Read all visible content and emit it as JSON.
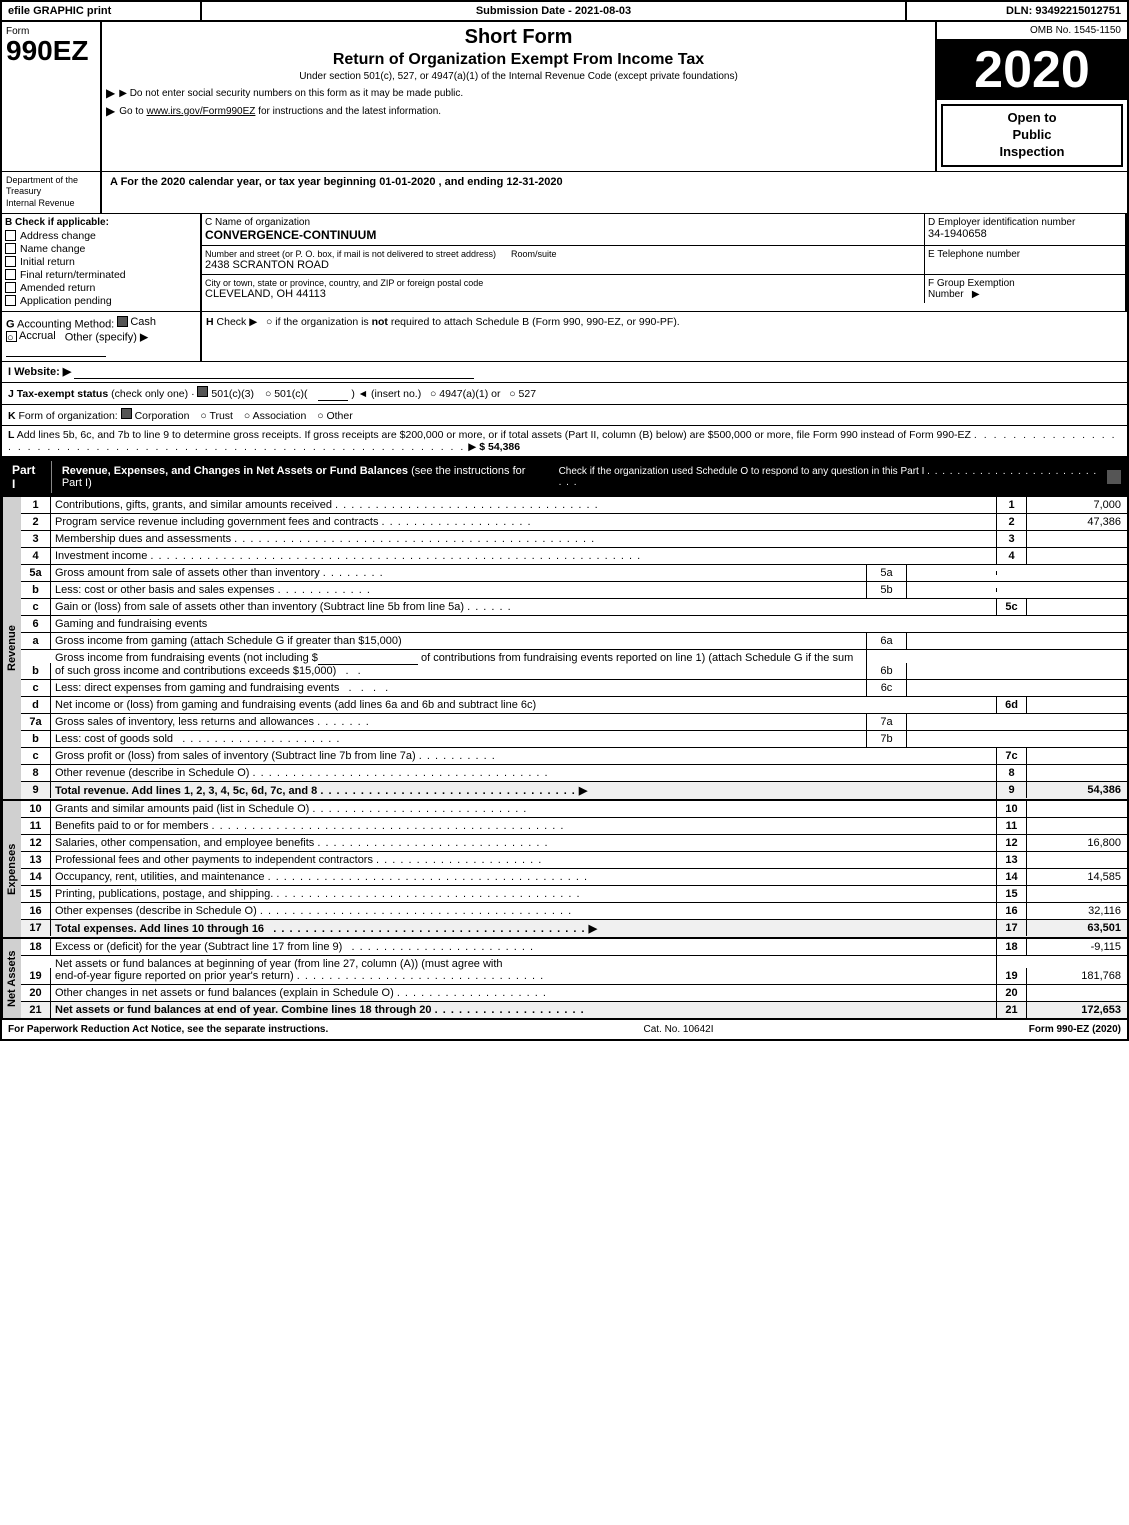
{
  "header": {
    "efile_label": "efile GRAPHIC print",
    "submission_label": "Submission Date - 2021-08-03",
    "dln_label": "DLN: 93492215012751"
  },
  "form": {
    "form_number": "990EZ",
    "short_form_title": "Short Form",
    "return_title": "Return of Organization Exempt From Income Tax",
    "subtitle": "Under section 501(c), 527, or 4947(a)(1) of the Internal Revenue Code (except private foundations)",
    "notice1": "▶ Do not enter social security numbers on this form as it may be made public.",
    "notice2": "▶ Go to www.irs.gov/Form990EZ for instructions and the latest information.",
    "omb": "OMB No. 1545-1150",
    "year": "2020",
    "open_to_public": "Open to\nPublic\nInspection",
    "dept": "Department of the Treasury\nInternal Revenue",
    "tax_year_line": "A For the 2020 calendar year, or tax year beginning 01-01-2020 , and ending 12-31-2020"
  },
  "section_b": {
    "label": "B Check if applicable:",
    "items": [
      {
        "id": "address_change",
        "label": "Address change",
        "checked": false
      },
      {
        "id": "name_change",
        "label": "Name change",
        "checked": false
      },
      {
        "id": "initial_return",
        "label": "Initial return",
        "checked": false
      },
      {
        "id": "final_return",
        "label": "Final return/terminated",
        "checked": false
      },
      {
        "id": "amended_return",
        "label": "Amended return",
        "checked": false
      },
      {
        "id": "application_pending",
        "label": "Application pending",
        "checked": false
      }
    ]
  },
  "section_c": {
    "label": "C Name of organization",
    "org_name": "CONVERGENCE-CONTINUUM"
  },
  "section_d": {
    "label": "D Employer identification number",
    "ein": "34-1940658"
  },
  "section_e": {
    "label": "E Telephone number"
  },
  "address": {
    "street_label": "Number and street (or P. O. box, if mail is not delivered to street address)",
    "room_label": "Room/suite",
    "street": "2438 SCRANTON ROAD",
    "city_label": "City or town, state or province, country, and ZIP or foreign postal code",
    "city": "CLEVELAND, OH  44113"
  },
  "section_f": {
    "label": "F Group Exemption\nNumber",
    "arrow": "▶"
  },
  "section_g": {
    "label": "G Accounting Method:",
    "cash_checked": true,
    "cash_label": "Cash",
    "accrual_label": "Accrual",
    "other_label": "Other (specify) ▶"
  },
  "section_h": {
    "label": "H Check ▶",
    "text": "○ if the organization is not required to attach Schedule B (Form 990, 990-EZ, or 990-PF)."
  },
  "section_i": {
    "label": "I Website: ▶"
  },
  "section_j": {
    "label": "J Tax-exempt status",
    "text": "(check only one) ·",
    "options": [
      "☑ 501(c)(3)",
      "○ 501(c)(",
      ") ◄ (insert no.)",
      "○ 4947(a)(1) or",
      "○ 527"
    ]
  },
  "section_k": {
    "label": "K Form of organization:",
    "options": [
      "☑ Corporation",
      "○ Trust",
      "○ Association",
      "○ Other"
    ]
  },
  "section_l": {
    "text": "L Add lines 5b, 6c, and 7b to line 9 to determine gross receipts. If gross receipts are $200,000 or more, or if total assets (Part II, column (B) below) are $500,000 or more, file Form 990 instead of Form 990-EZ",
    "dots": ". . . . . . . . . . . . . . . . . . . . . . . . . . . . . . . . . . . . . . . . . . . . . . . . . . . . . . . . . . .",
    "arrow": "▶",
    "value": "$ 54,386"
  },
  "part1": {
    "label": "Part I",
    "title": "Revenue, Expenses, and Changes in Net Assets or Fund Balances",
    "subtitle": "(see the instructions for Part I)",
    "check_note": "Check if the organization used Schedule O to respond to any question in this Part I",
    "check_dots": ". . . . . . . . . . . . . . . . . . . . . . . . .",
    "lines": [
      {
        "num": "1",
        "desc": "Contributions, gifts, grants, and similar amounts received",
        "dots": ". . . . . . . . . . . . . . . . . . . . . . . . . . . . . . . . .",
        "ref": "1",
        "value": "7,000"
      },
      {
        "num": "2",
        "desc": "Program service revenue including government fees and contracts",
        "dots": ". . . . . . . . . . . . . . . . . . .",
        "ref": "2",
        "value": "47,386"
      },
      {
        "num": "3",
        "desc": "Membership dues and assessments",
        "dots": ". . . . . . . . . . . . . . . . . . . . . . . . . . . . . . . . . . . . . . . . . . . . .",
        "ref": "3",
        "value": ""
      },
      {
        "num": "4",
        "desc": "Investment income",
        "dots": ". . . . . . . . . . . . . . . . . . . . . . . . . . . . . . . . . . . . . . . . . . . . . . . . . . . . . . . . . . . . .",
        "ref": "4",
        "value": ""
      },
      {
        "num": "5a",
        "desc": "Gross amount from sale of assets other than inventory",
        "dots": ". . . . . . . .",
        "sub": "5a",
        "value": ""
      },
      {
        "num": "b",
        "desc": "Less: cost or other basis and sales expenses",
        "dots": ". . . . . . . . . . . .",
        "sub": "5b",
        "value": ""
      },
      {
        "num": "c",
        "desc": "Gain or (loss) from sale of assets other than inventory (Subtract line 5b from line 5a)",
        "dots": ". . . . . .",
        "ref": "5c",
        "value": ""
      },
      {
        "num": "6",
        "desc": "Gaming and fundraising events",
        "dots": "",
        "ref": "",
        "value": ""
      },
      {
        "num": "a",
        "desc": "Gross income from gaming (attach Schedule G if greater than $15,000)",
        "sub": "6a",
        "value": ""
      },
      {
        "num": "b",
        "desc": "Gross income from fundraising events (not including $_____ of contributions from fundraising events reported on line 1) (attach Schedule G if the sum of such gross income and contributions exceeds $15,000)",
        "sub": "6b",
        "value": ""
      },
      {
        "num": "c",
        "desc": "Less: direct expenses from gaming and fundraising events",
        "dots": ". . . .",
        "sub": "6c",
        "value": ""
      },
      {
        "num": "d",
        "desc": "Net income or (loss) from gaming and fundraising events (add lines 6a and 6b and subtract line 6c)",
        "ref": "6d",
        "value": ""
      },
      {
        "num": "7a",
        "desc": "Gross sales of inventory, less returns and allowances",
        "dots": ". . . . . . .",
        "sub": "7a",
        "value": ""
      },
      {
        "num": "b",
        "desc": "Less: cost of goods sold",
        "dots": ". . . . . . . . . . . . . . . . . . . . .",
        "sub": "7b",
        "value": ""
      },
      {
        "num": "c",
        "desc": "Gross profit or (loss) from sales of inventory (Subtract line 7b from line 7a)",
        "dots": ". . . . . . . . . .",
        "ref": "7c",
        "value": ""
      },
      {
        "num": "8",
        "desc": "Other revenue (describe in Schedule O)",
        "dots": ". . . . . . . . . . . . . . . . . . . . . . . . . . . . . . . . . . . . .",
        "ref": "8",
        "value": ""
      },
      {
        "num": "9",
        "desc": "Total revenue. Add lines 1, 2, 3, 4, 5c, 6d, 7c, and 8",
        "dots": ". . . . . . . . . . . . . . . . . . . . . . . . . . . . . . . .",
        "arrow": "▶",
        "ref": "9",
        "value": "54,386",
        "bold": true
      }
    ]
  },
  "expenses": {
    "lines": [
      {
        "num": "10",
        "desc": "Grants and similar amounts paid (list in Schedule O)",
        "dots": ". . . . . . . . . . . . . . . . . . . . . . . . . . .",
        "ref": "10",
        "value": ""
      },
      {
        "num": "11",
        "desc": "Benefits paid to or for members",
        "dots": ". . . . . . . . . . . . . . . . . . . . . . . . . . . . . . . . . . . . . . . . . . . .",
        "ref": "11",
        "value": ""
      },
      {
        "num": "12",
        "desc": "Salaries, other compensation, and employee benefits",
        "dots": ". . . . . . . . . . . . . . . . . . . . . . . . . . . . .",
        "ref": "12",
        "value": "16,800"
      },
      {
        "num": "13",
        "desc": "Professional fees and other payments to independent contractors",
        "dots": ". . . . . . . . . . . . . . . . . . . . .",
        "ref": "13",
        "value": ""
      },
      {
        "num": "14",
        "desc": "Occupancy, rent, utilities, and maintenance",
        "dots": ". . . . . . . . . . . . . . . . . . . . . . . . . . . . . . . . . . . . . . . .",
        "ref": "14",
        "value": "14,585"
      },
      {
        "num": "15",
        "desc": "Printing, publications, postage, and shipping.",
        "dots": ". . . . . . . . . . . . . . . . . . . . . . . . . . . . . . . . . . . . . .",
        "ref": "15",
        "value": ""
      },
      {
        "num": "16",
        "desc": "Other expenses (describe in Schedule O)",
        "dots": ". . . . . . . . . . . . . . . . . . . . . . . . . . . . . . . . . . . . . . .",
        "ref": "16",
        "value": "32,116"
      },
      {
        "num": "17",
        "desc": "Total expenses. Add lines 10 through 16",
        "dots": ". . . . . . . . . . . . . . . . . . . . . . . . . . . . . . . . . . . . . . .",
        "arrow": "▶",
        "ref": "17",
        "value": "63,501",
        "bold": true
      }
    ]
  },
  "net_assets": {
    "lines": [
      {
        "num": "18",
        "desc": "Excess or (deficit) for the year (Subtract line 17 from line 9)",
        "dots": ". . . . . . . . . . . . . . . . . . . . . . . .",
        "ref": "18",
        "value": "-9,115"
      },
      {
        "num": "19",
        "desc": "Net assets or fund balances at beginning of year (from line 27, column (A)) (must agree with end-of-year figure reported on prior year's return)",
        "dots": ". . . . . . . . . . . . . . . . . . . . . . . . . . . . . . .",
        "ref": "19",
        "value": "181,768"
      },
      {
        "num": "20",
        "desc": "Other changes in net assets or fund balances (explain in Schedule O)",
        "dots": ". . . . . . . . . . . . . . . . . . . .",
        "ref": "20",
        "value": ""
      },
      {
        "num": "21",
        "desc": "Net assets or fund balances at end of year. Combine lines 18 through 20",
        "dots": ". . . . . . . . . . . . . . . . . . .",
        "ref": "21",
        "value": "172,653"
      }
    ]
  },
  "footer": {
    "left": "For Paperwork Reduction Act Notice, see the separate instructions.",
    "middle": "Cat. No. 10642I",
    "right": "Form 990-EZ (2020)"
  }
}
